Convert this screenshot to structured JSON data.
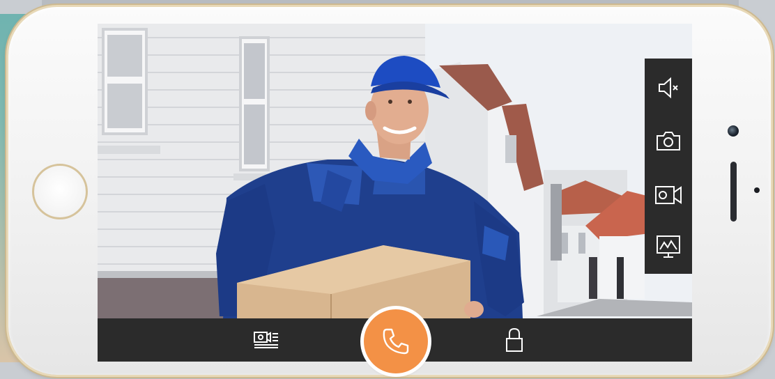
{
  "app": {
    "name": "doorbell-video-intercom"
  },
  "side_controls": [
    {
      "name": "mute-button",
      "icon": "speaker-muted-icon"
    },
    {
      "name": "snapshot-button",
      "icon": "camera-icon"
    },
    {
      "name": "record-button",
      "icon": "video-camera-icon"
    },
    {
      "name": "monitor-button",
      "icon": "monitor-icon"
    }
  ],
  "bottom_bar": {
    "left_icon": "intercom-list-icon",
    "center_icon": "phone-handset-icon",
    "right_icon": "lock-icon"
  },
  "colors": {
    "accent": "#f39146",
    "panel": "#2b2b2b",
    "icon": "#ffffff"
  }
}
